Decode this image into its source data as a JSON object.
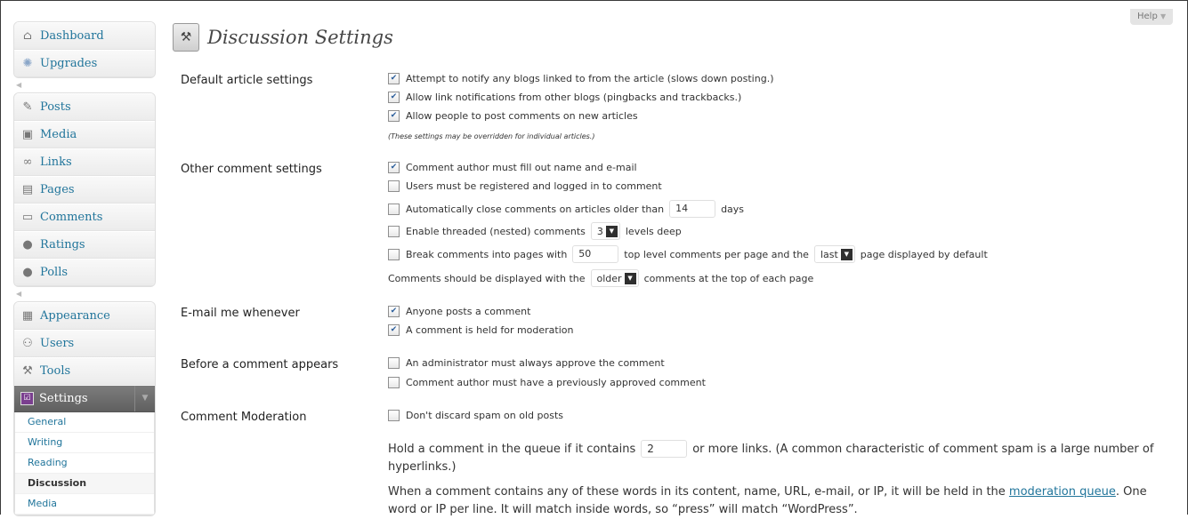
{
  "help": {
    "label": "Help",
    "arrow": "▼"
  },
  "page": {
    "title": "Discussion Settings",
    "icon": "settings-tools-icon"
  },
  "sidebar": {
    "group1": [
      {
        "label": "Dashboard",
        "icon": "home-icon"
      },
      {
        "label": "Upgrades",
        "icon": "upgrade-icon"
      }
    ],
    "group2": [
      {
        "label": "Posts",
        "icon": "pin-icon"
      },
      {
        "label": "Media",
        "icon": "media-icon"
      },
      {
        "label": "Links",
        "icon": "link-icon"
      },
      {
        "label": "Pages",
        "icon": "pages-icon"
      },
      {
        "label": "Comments",
        "icon": "comment-icon"
      },
      {
        "label": "Ratings",
        "icon": "circle-icon"
      },
      {
        "label": "Polls",
        "icon": "circle-icon"
      }
    ],
    "group3": [
      {
        "label": "Appearance",
        "icon": "appearance-icon"
      },
      {
        "label": "Users",
        "icon": "users-icon"
      },
      {
        "label": "Tools",
        "icon": "tools-icon"
      },
      {
        "label": "Settings",
        "icon": "settings-icon"
      }
    ],
    "submenu": [
      {
        "label": "General"
      },
      {
        "label": "Writing"
      },
      {
        "label": "Reading"
      },
      {
        "label": "Discussion"
      },
      {
        "label": "Media"
      }
    ]
  },
  "sections": {
    "default_article": {
      "label": "Default article settings",
      "items": [
        {
          "text": "Attempt to notify any blogs linked to from the article (slows down posting.)",
          "checked": true
        },
        {
          "text": "Allow link notifications from other blogs (pingbacks and trackbacks.)",
          "checked": true
        },
        {
          "text": "Allow people to post comments on new articles",
          "checked": true
        }
      ],
      "note": "(These settings may be overridden for individual articles.)"
    },
    "other_comment": {
      "label": "Other comment settings",
      "fill_name": "Comment author must fill out name and e-mail",
      "registered": "Users must be registered and logged in to comment",
      "autoclose_pre": "Automatically close comments on articles older than",
      "autoclose_value": "14",
      "autoclose_post": "days",
      "threaded_pre": "Enable threaded (nested) comments",
      "threaded_value": "3",
      "threaded_post": "levels deep",
      "paged_pre": "Break comments into pages with",
      "paged_value": "50",
      "paged_mid": "top level comments per page and the",
      "paged_select": "last",
      "paged_post": "page displayed by default",
      "order_pre": "Comments should be displayed with the",
      "order_select": "older",
      "order_post": "comments at the top of each page"
    },
    "email": {
      "label": "E-mail me whenever",
      "items": [
        {
          "text": "Anyone posts a comment",
          "checked": true
        },
        {
          "text": "A comment is held for moderation",
          "checked": true
        }
      ]
    },
    "before_appears": {
      "label": "Before a comment appears",
      "items": [
        {
          "text": "An administrator must always approve the comment",
          "checked": false
        },
        {
          "text": "Comment author must have a previously approved comment",
          "checked": false
        }
      ]
    },
    "moderation": {
      "label": "Comment Moderation",
      "spam": "Don't discard spam on old posts",
      "hold_pre": "Hold a comment in the queue if it contains",
      "hold_value": "2",
      "hold_post": "or more links. (A common characteristic of comment spam is a large number of hyperlinks.)",
      "words_pre": "When a comment contains any of these words in its content, name, URL, e-mail, or IP, it will be held in the",
      "words_link": "moderation queue",
      "words_post": ". One word or IP per line. It will match inside words, so “press” will match “WordPress”."
    }
  }
}
